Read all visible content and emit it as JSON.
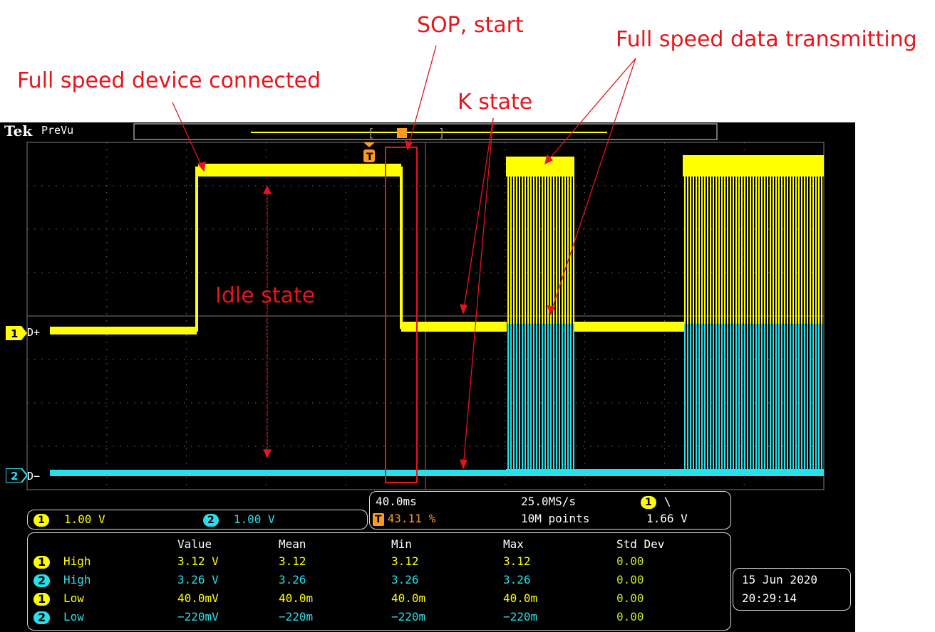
{
  "annotations": {
    "fs_connected": "Full speed device connected",
    "sop": "SOP, start",
    "k_state": "K state",
    "fs_data": "Full speed data transmitting",
    "idle": "Idle state"
  },
  "scope": {
    "brand": "Tek",
    "mode": "PreVu",
    "channels": [
      {
        "number": "1",
        "name": "D+",
        "color": "#ffff00",
        "scale": "1.00 V"
      },
      {
        "number": "2",
        "name": "D−",
        "color": "#27e1ea",
        "scale": "1.00 V"
      }
    ],
    "trigger_marker": "T",
    "horizontal": {
      "timebase": "40.0ms",
      "trigger_position": "43.11 %",
      "sample_rate": "25.0MS/s",
      "record_length": "10M points",
      "trigger_source": "1",
      "trigger_slope": "\\",
      "trigger_level": "1.66 V"
    },
    "measurements": {
      "headers": [
        "Value",
        "Mean",
        "Min",
        "Max",
        "Std Dev"
      ],
      "rows": [
        {
          "ch": "1",
          "label": "High",
          "values": [
            "3.12 V",
            "3.12",
            "3.12",
            "3.12",
            "0.00"
          ]
        },
        {
          "ch": "2",
          "label": "High",
          "values": [
            "3.26 V",
            "3.26",
            "3.26",
            "3.26",
            "0.00"
          ]
        },
        {
          "ch": "1",
          "label": "Low",
          "values": [
            "40.0mV",
            "40.0m",
            "40.0m",
            "40.0m",
            "0.00"
          ]
        },
        {
          "ch": "2",
          "label": "Low",
          "values": [
            "−220mV",
            "−220m",
            "−220m",
            "−220m",
            "0.00"
          ]
        }
      ]
    },
    "date": "15 Jun  2020",
    "time": "20:29:14"
  }
}
